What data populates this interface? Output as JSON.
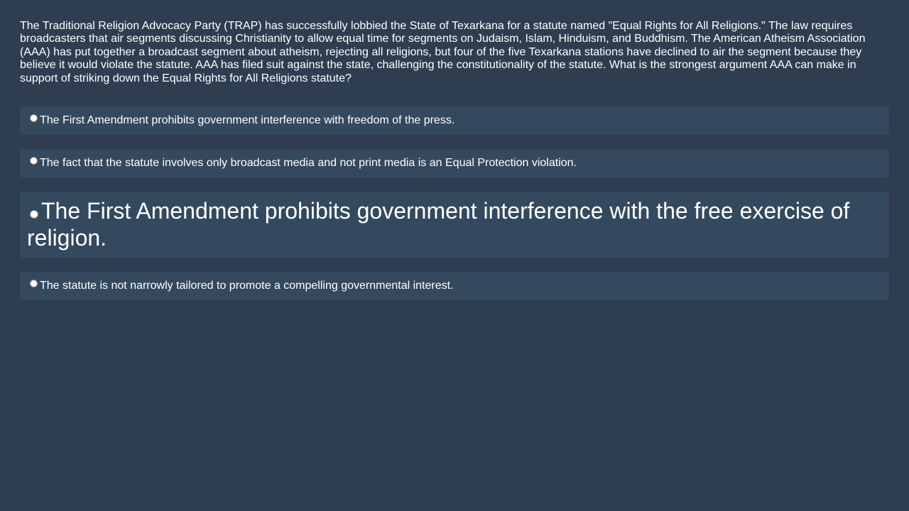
{
  "question": {
    "text": "The Traditional Religion Advocacy Party (TRAP) has successfully lobbied the State of Texarkana for a statute named \"Equal Rights for All Religions.\" The law requires broadcasters that air segments discussing Christianity to allow equal time for segments on Judaism, Islam, Hinduism, and Buddhism. The American Atheism Association (AAA) has put together a broadcast segment about atheism, rejecting all religions, but four of the five Texarkana stations have declined to air the segment because they believe it would violate the statute. AAA has filed suit against the state, challenging the constitutionality of the statute. What is the strongest argument AAA can make in support of striking down the Equal Rights for All Religions statute?"
  },
  "options": [
    {
      "label": "The First Amendment prohibits government interference with freedom of the press."
    },
    {
      "label": "The fact that the statute involves only broadcast media and not print media is an Equal Protection violation."
    },
    {
      "label": "The First Amendment prohibits government interference with the free exercise of religion."
    },
    {
      "label": "The statute is not narrowly tailored to promote a compelling governmental interest."
    }
  ],
  "colors": {
    "background": "#2e3e50",
    "option_background": "#34495e",
    "text": "#ffffff"
  }
}
